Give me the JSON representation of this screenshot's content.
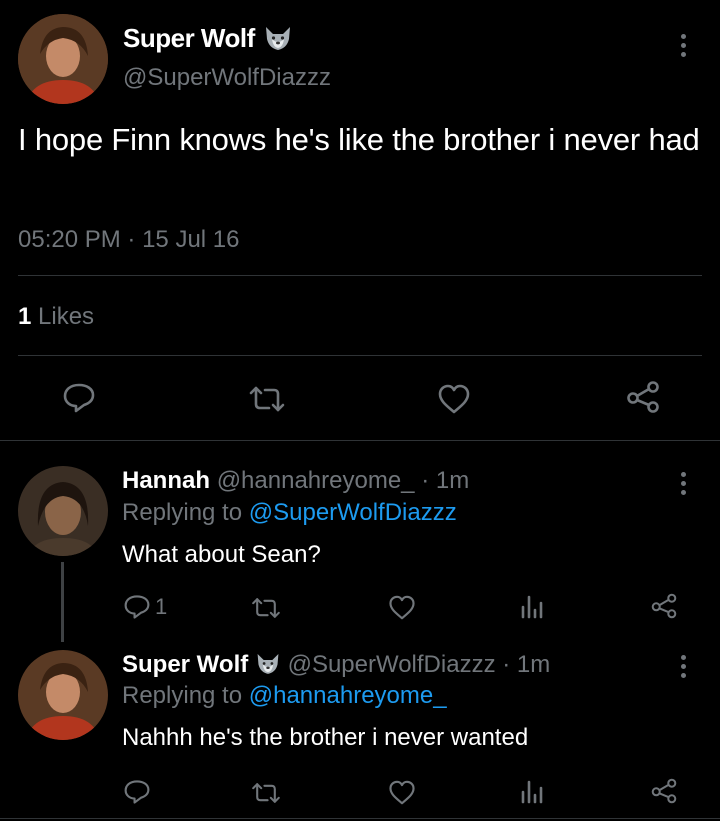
{
  "main_tweet": {
    "author_name": "Super Wolf",
    "author_handle": "@SuperWolfDiazzz",
    "text": "I hope Finn knows he's like the brother i never had",
    "time": "05:20 PM",
    "date": "15 Jul 16",
    "likes_count": "1",
    "likes_label": "Likes"
  },
  "replies": [
    {
      "author_name": "Hannah",
      "author_handle": "@hannahreyome_",
      "age": "1m",
      "replying_label": "Replying to",
      "replying_to": "@SuperWolfDiazzz",
      "text": "What about Sean?",
      "reply_count": "1"
    },
    {
      "author_name": "Super Wolf",
      "author_handle": "@SuperWolfDiazzz",
      "age": "1m",
      "replying_label": "Replying to",
      "replying_to": "@hannahreyome_",
      "text": "Nahhh he's the brother i never wanted"
    }
  ],
  "separator": "·",
  "icons": [
    "wolf-emoji-icon",
    "more-icon",
    "reply-icon",
    "retweet-icon",
    "like-icon",
    "share-icon",
    "analytics-icon"
  ],
  "colors": {
    "background": "#000000",
    "link": "#1d9bf0",
    "muted": "#71767b",
    "divider": "#2f3336"
  }
}
